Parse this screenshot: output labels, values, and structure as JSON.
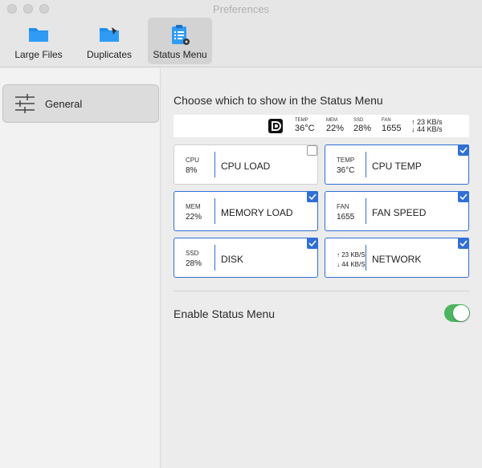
{
  "window": {
    "title": "Preferences"
  },
  "toolbar": {
    "items": [
      {
        "label": "Large Files",
        "icon": "folder-icon"
      },
      {
        "label": "Duplicates",
        "icon": "duplicates-folder-icon"
      },
      {
        "label": "Status Menu",
        "icon": "status-menu-icon",
        "active": true
      }
    ]
  },
  "sidebar": {
    "items": [
      {
        "label": "General",
        "icon": "sliders-icon",
        "selected": true
      }
    ]
  },
  "main": {
    "heading": "Choose which to show in the Status Menu",
    "preview": {
      "temp": {
        "title": "TEMP",
        "value": "36°C"
      },
      "mem": {
        "title": "MEM",
        "value": "22%"
      },
      "ssd": {
        "title": "SSD",
        "value": "28%"
      },
      "fan": {
        "title": "FAN",
        "value": "1655"
      },
      "net_up": "↑ 23 KB/s",
      "net_down": "↓ 44 KB/s"
    },
    "cards": [
      {
        "title": "CPU",
        "value": "8%",
        "name": "CPU LOAD",
        "checked": false
      },
      {
        "title": "TEMP",
        "value": "36°C",
        "name": "CPU TEMP",
        "checked": true
      },
      {
        "title": "MEM",
        "value": "22%",
        "name": "MEMORY LOAD",
        "checked": true
      },
      {
        "title": "FAN",
        "value": "1655",
        "name": "FAN SPEED",
        "checked": true
      },
      {
        "title": "SSD",
        "value": "28%",
        "name": "DISK",
        "checked": true
      },
      {
        "up": "↑ 23 KB/S",
        "down": "↓ 44 KB/S",
        "name": "NETWORK",
        "checked": true
      }
    ],
    "enable_label": "Enable Status Menu",
    "enable_on": true
  },
  "colors": {
    "accent": "#2f6fd6",
    "toggle_on": "#4cb560",
    "folder": "#1e8ef0"
  }
}
